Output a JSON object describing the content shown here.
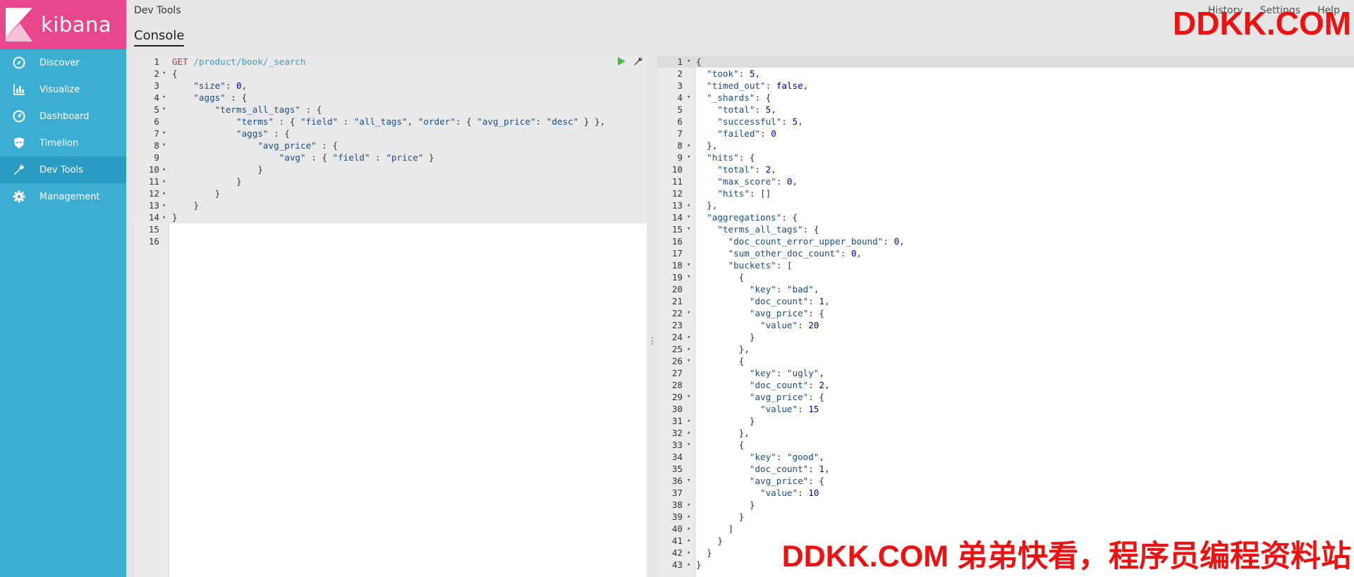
{
  "app": {
    "logo_text": "kibana"
  },
  "sidebar": {
    "items": [
      {
        "label": "Discover",
        "icon": "compass-icon",
        "active": false
      },
      {
        "label": "Visualize",
        "icon": "bar-chart-icon",
        "active": false
      },
      {
        "label": "Dashboard",
        "icon": "dashboard-icon",
        "active": false
      },
      {
        "label": "Timelion",
        "icon": "timelion-icon",
        "active": false
      },
      {
        "label": "Dev Tools",
        "icon": "wrench-icon",
        "active": true
      },
      {
        "label": "Management",
        "icon": "gear-icon",
        "active": false
      }
    ]
  },
  "header": {
    "breadcrumb": "Dev Tools",
    "tab": "Console",
    "links": [
      "History",
      "Settings",
      "Help"
    ]
  },
  "watermarks": {
    "top": "DDKK.COM",
    "bottom": "DDKK.COM 弟弟快看，程序员编程资料站"
  },
  "request": {
    "lines": [
      [
        [
          "m",
          "GET"
        ],
        [
          "p",
          " "
        ],
        [
          "u",
          "/product/book/_search"
        ]
      ],
      [
        [
          "p",
          "{"
        ]
      ],
      [
        [
          "p",
          "    "
        ],
        [
          "k",
          "\"size\""
        ],
        [
          "p",
          ": "
        ],
        [
          "n",
          "0"
        ],
        [
          "p",
          ","
        ]
      ],
      [
        [
          "p",
          "    "
        ],
        [
          "k",
          "\"aggs\""
        ],
        [
          "p",
          " : {"
        ]
      ],
      [
        [
          "p",
          "        "
        ],
        [
          "k",
          "\"terms_all_tags\""
        ],
        [
          "p",
          " : {"
        ]
      ],
      [
        [
          "p",
          "            "
        ],
        [
          "k",
          "\"terms\""
        ],
        [
          "p",
          " : { "
        ],
        [
          "k",
          "\"field\""
        ],
        [
          "p",
          " : "
        ],
        [
          "s",
          "\"all_tags\""
        ],
        [
          "p",
          ", "
        ],
        [
          "k",
          "\"order\""
        ],
        [
          "p",
          ": { "
        ],
        [
          "k",
          "\"avg_price\""
        ],
        [
          "p",
          ": "
        ],
        [
          "s",
          "\"desc\""
        ],
        [
          "p",
          " } },"
        ]
      ],
      [
        [
          "p",
          "            "
        ],
        [
          "k",
          "\"aggs\""
        ],
        [
          "p",
          " : {"
        ]
      ],
      [
        [
          "p",
          "                "
        ],
        [
          "k",
          "\"avg_price\""
        ],
        [
          "p",
          " : {"
        ]
      ],
      [
        [
          "p",
          "                    "
        ],
        [
          "k",
          "\"avg\""
        ],
        [
          "p",
          " : { "
        ],
        [
          "k",
          "\"field\""
        ],
        [
          "p",
          " : "
        ],
        [
          "s",
          "\"price\""
        ],
        [
          "p",
          " }"
        ]
      ],
      [
        [
          "p",
          "                }"
        ]
      ],
      [
        [
          "p",
          "            }"
        ]
      ],
      [
        [
          "p",
          "        }"
        ]
      ],
      [
        [
          "p",
          "    }"
        ]
      ],
      [
        [
          "p",
          "}"
        ]
      ],
      [],
      []
    ],
    "folds": [
      "",
      "▾",
      "",
      "▾",
      "▾",
      "",
      "▾",
      "▾",
      "",
      "▴",
      "▴",
      "▴",
      "▴",
      "▴",
      "",
      ""
    ]
  },
  "response": {
    "lines": [
      [
        [
          "p",
          "{"
        ]
      ],
      [
        [
          "p",
          "  "
        ],
        [
          "k",
          "\"took\""
        ],
        [
          "p",
          ": "
        ],
        [
          "n",
          "5"
        ],
        [
          "p",
          ","
        ]
      ],
      [
        [
          "p",
          "  "
        ],
        [
          "k",
          "\"timed_out\""
        ],
        [
          "p",
          ": "
        ],
        [
          "b",
          "false"
        ],
        [
          "p",
          ","
        ]
      ],
      [
        [
          "p",
          "  "
        ],
        [
          "k",
          "\"_shards\""
        ],
        [
          "p",
          ": {"
        ]
      ],
      [
        [
          "p",
          "    "
        ],
        [
          "k",
          "\"total\""
        ],
        [
          "p",
          ": "
        ],
        [
          "n",
          "5"
        ],
        [
          "p",
          ","
        ]
      ],
      [
        [
          "p",
          "    "
        ],
        [
          "k",
          "\"successful\""
        ],
        [
          "p",
          ": "
        ],
        [
          "n",
          "5"
        ],
        [
          "p",
          ","
        ]
      ],
      [
        [
          "p",
          "    "
        ],
        [
          "k",
          "\"failed\""
        ],
        [
          "p",
          ": "
        ],
        [
          "n",
          "0"
        ]
      ],
      [
        [
          "p",
          "  },"
        ]
      ],
      [
        [
          "p",
          "  "
        ],
        [
          "k",
          "\"hits\""
        ],
        [
          "p",
          ": {"
        ]
      ],
      [
        [
          "p",
          "    "
        ],
        [
          "k",
          "\"total\""
        ],
        [
          "p",
          ": "
        ],
        [
          "n",
          "2"
        ],
        [
          "p",
          ","
        ]
      ],
      [
        [
          "p",
          "    "
        ],
        [
          "k",
          "\"max_score\""
        ],
        [
          "p",
          ": "
        ],
        [
          "n",
          "0"
        ],
        [
          "p",
          ","
        ]
      ],
      [
        [
          "p",
          "    "
        ],
        [
          "k",
          "\"hits\""
        ],
        [
          "p",
          ": []"
        ]
      ],
      [
        [
          "p",
          "  },"
        ]
      ],
      [
        [
          "p",
          "  "
        ],
        [
          "k",
          "\"aggregations\""
        ],
        [
          "p",
          ": {"
        ]
      ],
      [
        [
          "p",
          "    "
        ],
        [
          "k",
          "\"terms_all_tags\""
        ],
        [
          "p",
          ": {"
        ]
      ],
      [
        [
          "p",
          "      "
        ],
        [
          "k",
          "\"doc_count_error_upper_bound\""
        ],
        [
          "p",
          ": "
        ],
        [
          "n",
          "0"
        ],
        [
          "p",
          ","
        ]
      ],
      [
        [
          "p",
          "      "
        ],
        [
          "k",
          "\"sum_other_doc_count\""
        ],
        [
          "p",
          ": "
        ],
        [
          "n",
          "0"
        ],
        [
          "p",
          ","
        ]
      ],
      [
        [
          "p",
          "      "
        ],
        [
          "k",
          "\"buckets\""
        ],
        [
          "p",
          ": ["
        ]
      ],
      [
        [
          "p",
          "        {"
        ]
      ],
      [
        [
          "p",
          "          "
        ],
        [
          "k",
          "\"key\""
        ],
        [
          "p",
          ": "
        ],
        [
          "s",
          "\"bad\""
        ],
        [
          "p",
          ","
        ]
      ],
      [
        [
          "p",
          "          "
        ],
        [
          "k",
          "\"doc_count\""
        ],
        [
          "p",
          ": "
        ],
        [
          "n",
          "1"
        ],
        [
          "p",
          ","
        ]
      ],
      [
        [
          "p",
          "          "
        ],
        [
          "k",
          "\"avg_price\""
        ],
        [
          "p",
          ": {"
        ]
      ],
      [
        [
          "p",
          "            "
        ],
        [
          "k",
          "\"value\""
        ],
        [
          "p",
          ": "
        ],
        [
          "n",
          "20"
        ]
      ],
      [
        [
          "p",
          "          }"
        ]
      ],
      [
        [
          "p",
          "        },"
        ]
      ],
      [
        [
          "p",
          "        {"
        ]
      ],
      [
        [
          "p",
          "          "
        ],
        [
          "k",
          "\"key\""
        ],
        [
          "p",
          ": "
        ],
        [
          "s",
          "\"ugly\""
        ],
        [
          "p",
          ","
        ]
      ],
      [
        [
          "p",
          "          "
        ],
        [
          "k",
          "\"doc_count\""
        ],
        [
          "p",
          ": "
        ],
        [
          "n",
          "2"
        ],
        [
          "p",
          ","
        ]
      ],
      [
        [
          "p",
          "          "
        ],
        [
          "k",
          "\"avg_price\""
        ],
        [
          "p",
          ": {"
        ]
      ],
      [
        [
          "p",
          "            "
        ],
        [
          "k",
          "\"value\""
        ],
        [
          "p",
          ": "
        ],
        [
          "n",
          "15"
        ]
      ],
      [
        [
          "p",
          "          }"
        ]
      ],
      [
        [
          "p",
          "        },"
        ]
      ],
      [
        [
          "p",
          "        {"
        ]
      ],
      [
        [
          "p",
          "          "
        ],
        [
          "k",
          "\"key\""
        ],
        [
          "p",
          ": "
        ],
        [
          "s",
          "\"good\""
        ],
        [
          "p",
          ","
        ]
      ],
      [
        [
          "p",
          "          "
        ],
        [
          "k",
          "\"doc_count\""
        ],
        [
          "p",
          ": "
        ],
        [
          "n",
          "1"
        ],
        [
          "p",
          ","
        ]
      ],
      [
        [
          "p",
          "          "
        ],
        [
          "k",
          "\"avg_price\""
        ],
        [
          "p",
          ": {"
        ]
      ],
      [
        [
          "p",
          "            "
        ],
        [
          "k",
          "\"value\""
        ],
        [
          "p",
          ": "
        ],
        [
          "n",
          "10"
        ]
      ],
      [
        [
          "p",
          "          }"
        ]
      ],
      [
        [
          "p",
          "        }"
        ]
      ],
      [
        [
          "p",
          "      ]"
        ]
      ],
      [
        [
          "p",
          "    }"
        ]
      ],
      [
        [
          "p",
          "  }"
        ]
      ],
      [
        [
          "p",
          "}"
        ]
      ]
    ],
    "folds": [
      "▾",
      "",
      "",
      "▾",
      "",
      "",
      "",
      "▴",
      "▾",
      "",
      "",
      "",
      "▴",
      "▾",
      "▾",
      "",
      "",
      "▾",
      "▾",
      "",
      "",
      "▾",
      "",
      "▴",
      "▴",
      "▾",
      "",
      "",
      "▾",
      "",
      "▴",
      "▴",
      "▾",
      "",
      "",
      "▾",
      "",
      "▴",
      "▴",
      "▴",
      "▴",
      "▴",
      "▴"
    ]
  }
}
